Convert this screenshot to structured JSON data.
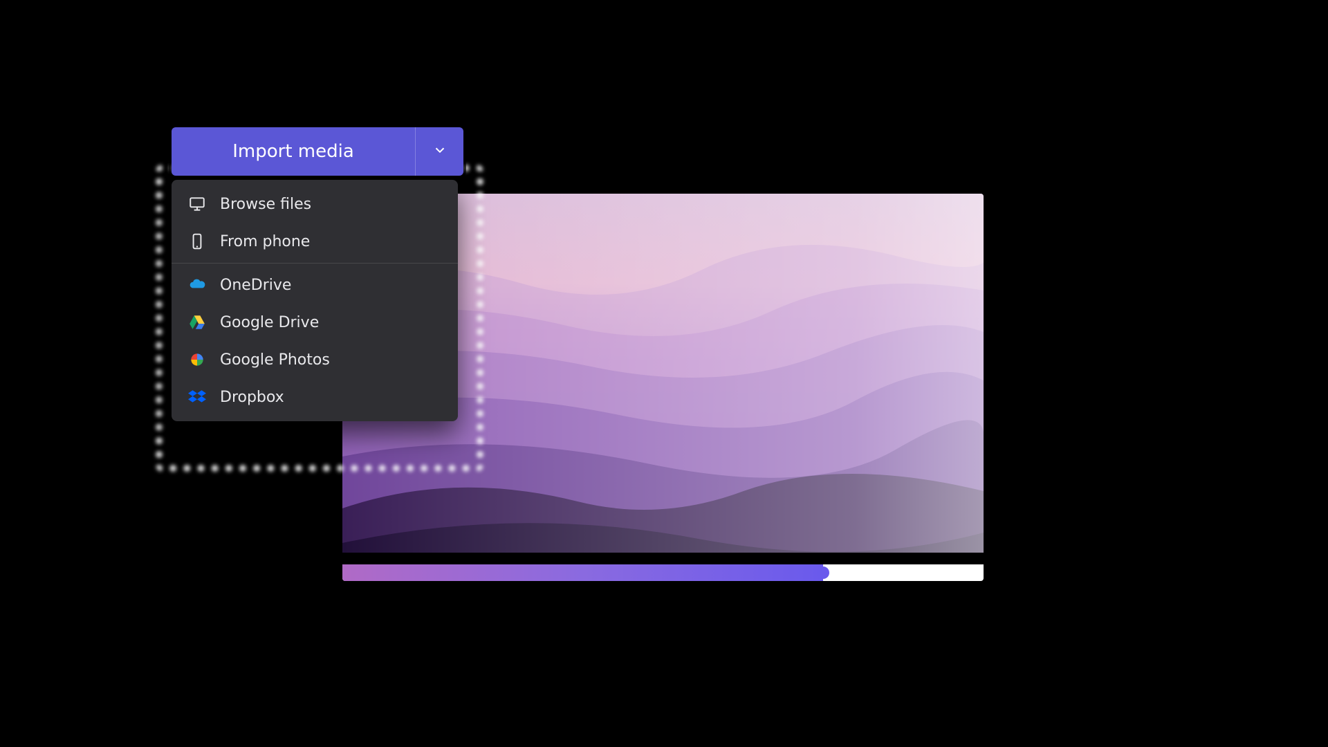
{
  "import": {
    "button_label": "Import media",
    "menu": {
      "browse_files": "Browse files",
      "from_phone": "From phone",
      "onedrive": "OneDrive",
      "google_drive": "Google Drive",
      "google_photos": "Google Photos",
      "dropbox": "Dropbox"
    }
  },
  "colors": {
    "accent": "#5b57d6",
    "panel": "#2f2f33",
    "track_fill_start": "#b06ac6",
    "track_fill_end": "#6a5aec"
  },
  "timeline": {
    "progress_pct": 75
  }
}
